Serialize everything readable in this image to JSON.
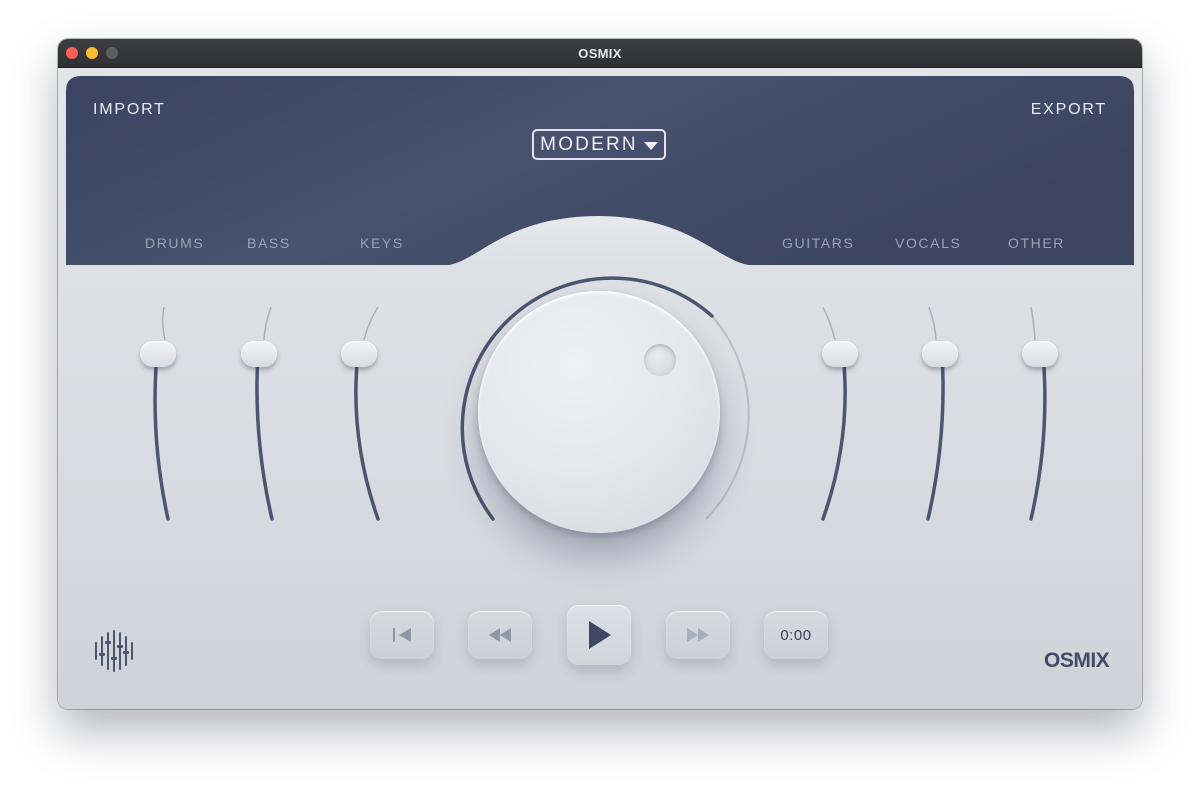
{
  "window": {
    "title": "OSMIX"
  },
  "header": {
    "import_label": "IMPORT",
    "export_label": "EXPORT",
    "preset": "MODERN"
  },
  "channels": [
    {
      "label": "DRUMS"
    },
    {
      "label": "BASS"
    },
    {
      "label": "KEYS"
    },
    {
      "label": "GUITARS"
    },
    {
      "label": "VOCALS"
    },
    {
      "label": "OTHER"
    }
  ],
  "transport": {
    "time": "0:00",
    "buttons": [
      "skip-back-icon",
      "rewind-icon",
      "play-icon",
      "fast-forward-icon"
    ]
  },
  "brand": "OSMIX",
  "colors": {
    "header_bg": "#404b65",
    "accent": "#4a5570",
    "panel_bg": "#dcdfe4",
    "label": "#9aa3b6"
  }
}
